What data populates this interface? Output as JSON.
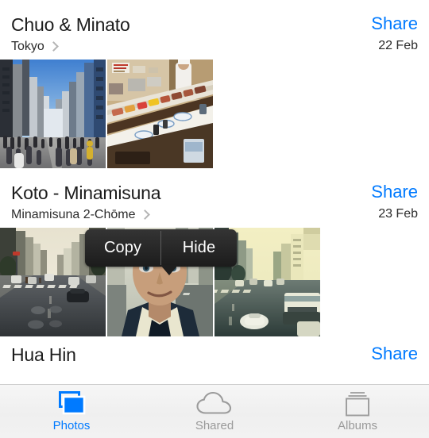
{
  "app": {
    "name": "Photos",
    "accent_color": "#007aff",
    "text_color": "#1c1c1c",
    "inactive_color": "#9a9a9a"
  },
  "moments": [
    {
      "title": "Chuo & Minato",
      "subtitle": "Tokyo",
      "share_label": "Share",
      "date": "22 Feb",
      "photos": [
        {
          "alt": "tokyo-street-crowd"
        },
        {
          "alt": "sushi-counter"
        }
      ]
    },
    {
      "title": "Koto - Minamisuna",
      "subtitle": "Minamisuna 2-Chōme",
      "share_label": "Share",
      "date": "23 Feb",
      "photos": [
        {
          "alt": "wide-road-crosswalk"
        },
        {
          "alt": "selfie-portrait"
        },
        {
          "alt": "yellow-toned-avenue"
        }
      ]
    },
    {
      "title": "Hua Hin",
      "subtitle": "",
      "share_label": "Share",
      "date": "",
      "photos": []
    }
  ],
  "context_menu": {
    "visible": true,
    "items": [
      {
        "label": "Copy",
        "name": "copy"
      },
      {
        "label": "Hide",
        "name": "hide"
      }
    ]
  },
  "tabbar": {
    "tabs": [
      {
        "label": "Photos",
        "icon": "photos-stack-icon",
        "active": true
      },
      {
        "label": "Shared",
        "icon": "cloud-icon",
        "active": false
      },
      {
        "label": "Albums",
        "icon": "albums-stack-icon",
        "active": false
      }
    ]
  }
}
